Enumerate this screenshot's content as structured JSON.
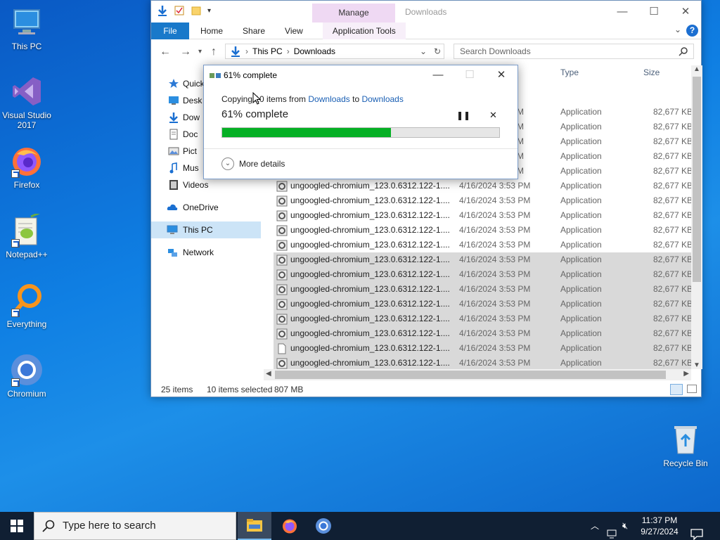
{
  "desktop": {
    "icons": [
      {
        "label": "This PC"
      },
      {
        "label": "Visual Studio 2017"
      },
      {
        "label": "Firefox"
      },
      {
        "label": "Notepad++"
      },
      {
        "label": "Everything"
      },
      {
        "label": "Chromium"
      },
      {
        "label": "Recycle Bin"
      }
    ]
  },
  "explorer": {
    "title": "Downloads",
    "manage_tab": "Manage",
    "ribbon_tabs": [
      "File",
      "Home",
      "Share",
      "View",
      "Application Tools"
    ],
    "address": {
      "segments": [
        "This PC",
        "Downloads"
      ]
    },
    "search_placeholder": "Search Downloads",
    "nav": [
      {
        "label": "Quick"
      },
      {
        "label": "Desk"
      },
      {
        "label": "Dow"
      },
      {
        "label": "Doc"
      },
      {
        "label": "Pict"
      },
      {
        "label": "Mus"
      },
      {
        "label": "Videos"
      },
      {
        "label": "OneDrive"
      },
      {
        "label": "This PC"
      },
      {
        "label": "Network"
      }
    ],
    "columns": {
      "type": "Type",
      "size": "Size"
    },
    "rows_partial": [
      {
        "date": "M",
        "type": "Application",
        "size": "82,677 KB"
      },
      {
        "date": "M",
        "type": "Application",
        "size": "82,677 KB"
      },
      {
        "date": "M",
        "type": "Application",
        "size": "82,677 KB"
      },
      {
        "date": "M",
        "type": "Application",
        "size": "82,677 KB"
      },
      {
        "date": "M",
        "type": "Application",
        "size": "82,677 KB"
      }
    ],
    "rows": [
      {
        "name": "ungoogled-chromium_123.0.6312.122-1....",
        "date": "4/16/2024 3:53 PM",
        "type": "Application",
        "size": "82,677 KB"
      },
      {
        "name": "ungoogled-chromium_123.0.6312.122-1....",
        "date": "4/16/2024 3:53 PM",
        "type": "Application",
        "size": "82,677 KB"
      },
      {
        "name": "ungoogled-chromium_123.0.6312.122-1....",
        "date": "4/16/2024 3:53 PM",
        "type": "Application",
        "size": "82,677 KB"
      },
      {
        "name": "ungoogled-chromium_123.0.6312.122-1....",
        "date": "4/16/2024 3:53 PM",
        "type": "Application",
        "size": "82,677 KB"
      },
      {
        "name": "ungoogled-chromium_123.0.6312.122-1....",
        "date": "4/16/2024 3:53 PM",
        "type": "Application",
        "size": "82,677 KB"
      },
      {
        "name": "ungoogled-chromium_123.0.6312.122-1....",
        "date": "4/16/2024 3:53 PM",
        "type": "Application",
        "size": "82,677 KB"
      },
      {
        "name": "ungoogled-chromium_123.0.6312.122-1....",
        "date": "4/16/2024 3:53 PM",
        "type": "Application",
        "size": "82,677 KB"
      },
      {
        "name": "ungoogled-chromium_123.0.6312.122-1....",
        "date": "4/16/2024 3:53 PM",
        "type": "Application",
        "size": "82,677 KB"
      },
      {
        "name": "ungoogled-chromium_123.0.6312.122-1....",
        "date": "4/16/2024 3:53 PM",
        "type": "Application",
        "size": "82,677 KB"
      },
      {
        "name": "ungoogled-chromium_123.0.6312.122-1....",
        "date": "4/16/2024 3:53 PM",
        "type": "Application",
        "size": "82,677 KB"
      },
      {
        "name": "ungoogled-chromium_123.0.6312.122-1....",
        "date": "4/16/2024 3:53 PM",
        "type": "Application",
        "size": "82,677 KB"
      },
      {
        "name": "ungoogled-chromium_123.0.6312.122-1....",
        "date": "4/16/2024 3:53 PM",
        "type": "Application",
        "size": "82,677 KB"
      },
      {
        "name": "ungoogled-chromium_123.0.6312.122-1....",
        "date": "4/16/2024 3:53 PM",
        "type": "Application",
        "size": "82,677 KB"
      }
    ],
    "status": {
      "items": "25 items",
      "selected": "10 items selected",
      "size": "807 MB"
    }
  },
  "dialog": {
    "title": "61% complete",
    "copy_prefix": "Copying 10 items from",
    "source": "Downloads",
    "to_word": "to",
    "dest": "Downloads",
    "percent_text": "61% complete",
    "progress": 0.61,
    "more_details": "More details"
  },
  "taskbar": {
    "search_placeholder": "Type here to search",
    "time": "11:37 PM",
    "date": "9/27/2024"
  },
  "colors": {
    "accent": "#1979ca",
    "progress": "#06b025",
    "selection": "#d9d9d9"
  }
}
